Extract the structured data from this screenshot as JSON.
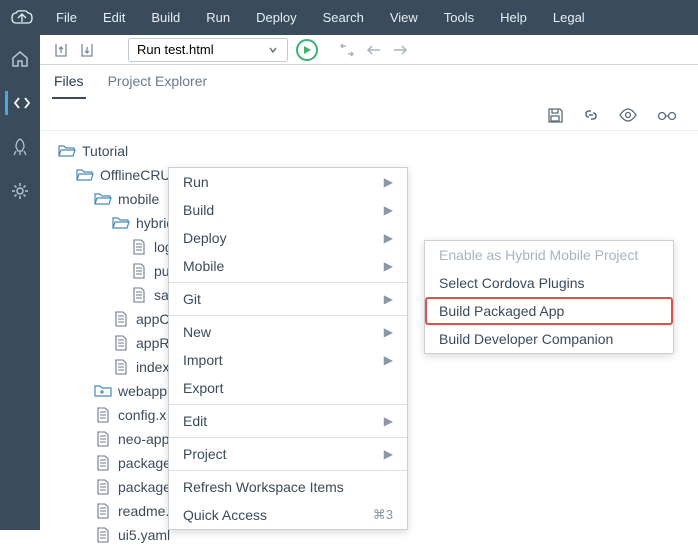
{
  "topbar": {
    "menu": [
      "File",
      "Edit",
      "Build",
      "Run",
      "Deploy",
      "Search",
      "View",
      "Tools",
      "Help",
      "Legal"
    ]
  },
  "toolbar": {
    "run_config": "Run test.html"
  },
  "tabs": {
    "files": "Files",
    "project_explorer": "Project Explorer"
  },
  "tree": [
    {
      "indent": 0,
      "type": "folder-open",
      "label": "Tutorial"
    },
    {
      "indent": 1,
      "type": "folder-open",
      "label": "OfflineCRUDDemo"
    },
    {
      "indent": 2,
      "type": "folder-open",
      "label": "mobile"
    },
    {
      "indent": 3,
      "type": "folder-open",
      "label": "hybrid"
    },
    {
      "indent": 4,
      "type": "file",
      "label": "log"
    },
    {
      "indent": 4,
      "type": "file",
      "label": "pul"
    },
    {
      "indent": 4,
      "type": "file",
      "label": "sap"
    },
    {
      "indent": 3,
      "type": "file",
      "label": "appC"
    },
    {
      "indent": 3,
      "type": "file",
      "label": "appR"
    },
    {
      "indent": 3,
      "type": "file",
      "label": "index"
    },
    {
      "indent": 2,
      "type": "folder-add",
      "label": "webapp"
    },
    {
      "indent": 2,
      "type": "file",
      "label": "config.x"
    },
    {
      "indent": 2,
      "type": "file",
      "label": "neo-app"
    },
    {
      "indent": 2,
      "type": "file",
      "label": "package"
    },
    {
      "indent": 2,
      "type": "file",
      "label": "package.json"
    },
    {
      "indent": 2,
      "type": "file",
      "label": "readme.txt"
    },
    {
      "indent": 2,
      "type": "file",
      "label": "ui5.yaml"
    }
  ],
  "context_menu": {
    "items": [
      {
        "label": "Run",
        "arrow": true
      },
      {
        "label": "Build",
        "arrow": true
      },
      {
        "label": "Deploy",
        "arrow": true
      },
      {
        "label": "Mobile",
        "arrow": true,
        "sep_after": true
      },
      {
        "label": "Git",
        "arrow": true,
        "sep_after": true
      },
      {
        "label": "New",
        "arrow": true
      },
      {
        "label": "Import",
        "arrow": true
      },
      {
        "label": "Export",
        "sep_after": true
      },
      {
        "label": "Edit",
        "arrow": true,
        "sep_after": true
      },
      {
        "label": "Project",
        "arrow": true,
        "sep_after": true
      },
      {
        "label": "Refresh Workspace Items"
      },
      {
        "label": "Quick Access",
        "shortcut": "⌘3"
      }
    ]
  },
  "submenu": {
    "items": [
      {
        "label": "Enable as Hybrid Mobile Project",
        "disabled": true
      },
      {
        "label": "Select Cordova Plugins"
      },
      {
        "label": "Build Packaged App",
        "highlighted": true
      },
      {
        "label": "Build Developer Companion"
      }
    ]
  }
}
